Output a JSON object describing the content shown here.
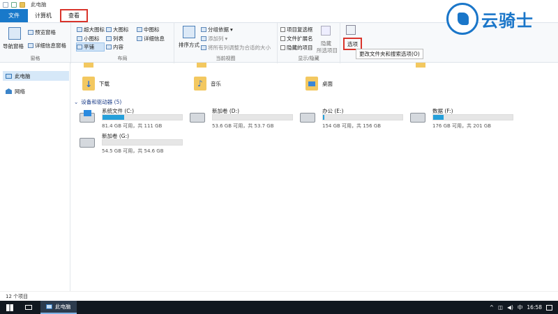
{
  "window": {
    "title": "此电脑"
  },
  "tabs": [
    {
      "label": "文件"
    },
    {
      "label": "计算机"
    },
    {
      "label": "查看"
    }
  ],
  "ribbon": {
    "panes": {
      "nav_pane": "导航窗格",
      "preview": "预览窗格",
      "details": "详细信息窗格",
      "label": "窗格"
    },
    "layout": {
      "items": [
        "超大图标",
        "大图标",
        "中图标",
        "小图标",
        "列表",
        "详细信息",
        "平铺",
        "内容"
      ],
      "label": "布局"
    },
    "current_view": {
      "sort": "排序方式",
      "group_by": "分组依据",
      "add_col": "添加列",
      "fit_cols": "将所有列调整为合适的大小",
      "label": "当前视图"
    },
    "show_hide": {
      "item_checkbox": "项目复选框",
      "file_ext": "文件扩展名",
      "hidden_items": "隐藏的项目",
      "hide_selected_1": "隐藏",
      "hide_selected_2": "所选项目",
      "label": "显示/隐藏"
    },
    "options": {
      "label": "选项"
    },
    "tooltip": "更改文件夹和搜索选项(O)"
  },
  "logo": {
    "text": "云骑士"
  },
  "nav": {
    "items": [
      {
        "label": "此电脑"
      },
      {
        "label": "网络"
      }
    ]
  },
  "folders": [
    {
      "name": "下载"
    },
    {
      "name": "音乐"
    },
    {
      "name": "桌面"
    }
  ],
  "section": {
    "title": "设备和驱动器 (5)"
  },
  "drives": [
    {
      "name": "系统文件 (C:)",
      "free": "81.4 GB 可用，共 111 GB",
      "used_fraction": 0.27
    },
    {
      "name": "新加卷 (D:)",
      "free": "53.6 GB 可用，共 53.7 GB",
      "used_fraction": 0.0
    },
    {
      "name": "办公 (E:)",
      "free": "154 GB 可用，共 156 GB",
      "used_fraction": 0.02
    },
    {
      "name": "数据 (F:)",
      "free": "176 GB 可用，共 201 GB",
      "used_fraction": 0.13
    },
    {
      "name": "新加卷 (G:)",
      "free": "54.5 GB 可用，共 54.6 GB",
      "used_fraction": 0.0
    }
  ],
  "status": {
    "count": "12 个项目"
  },
  "taskbar": {
    "app": "此电脑",
    "ime": "中",
    "time": "16:58"
  },
  "colors": {
    "accent": "#1979ca",
    "highlight_box": "#d9342b",
    "bar_fill": "#26a0da"
  }
}
